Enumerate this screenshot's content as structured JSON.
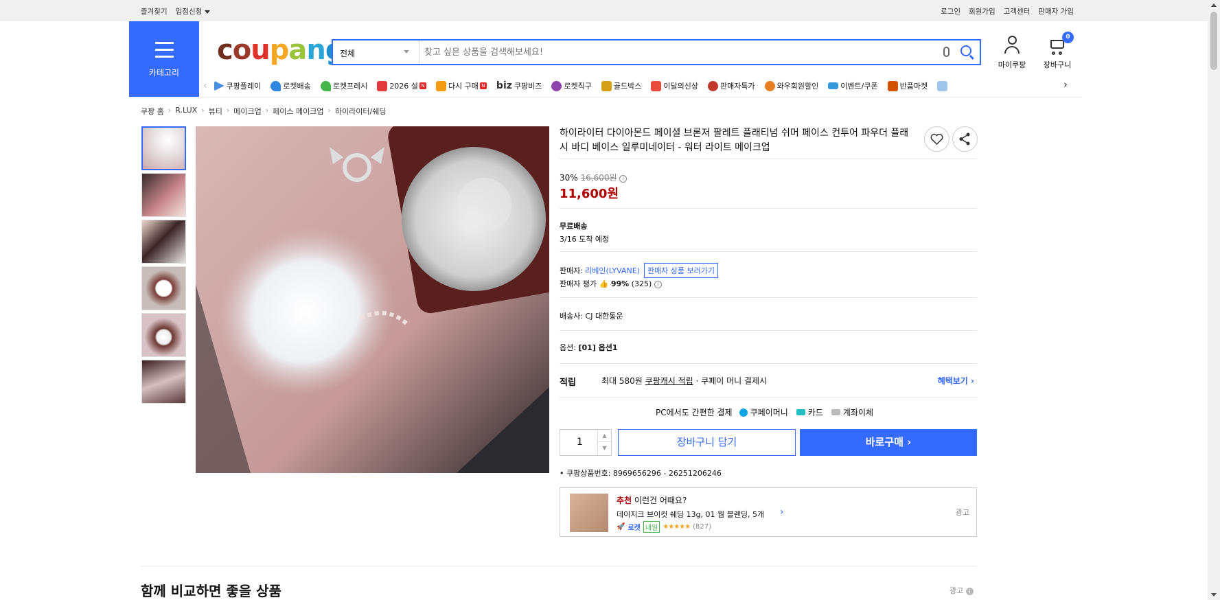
{
  "topbar": {
    "left": [
      "즐겨찾기",
      "입점신청"
    ],
    "right": [
      "로그인",
      "회원가입",
      "고객센터",
      "판매자 가입"
    ]
  },
  "header": {
    "category_label": "카테고리",
    "logo": [
      "c",
      "o",
      "u",
      "p",
      "a",
      "n",
      "g"
    ],
    "search_select": "전체",
    "search_placeholder": "찾고 싶은 상품을 검색해보세요!",
    "mycoupang": "마이쿠팡",
    "cart": "장바구니",
    "cart_count": "0"
  },
  "nav": {
    "items": [
      {
        "label": "쿠팡플레이",
        "icon": "play-icon",
        "color": "#4a90e2"
      },
      {
        "label": "로켓배송",
        "icon": "rocket-icon",
        "color": "#2e86de"
      },
      {
        "label": "로켓프레시",
        "icon": "rocket-fresh-icon",
        "color": "#44b549"
      },
      {
        "label": "2026 설",
        "icon": "gift-icon",
        "color": "#e23b3b",
        "badge": "N"
      },
      {
        "label": "다시 구매",
        "icon": "bag-icon",
        "color": "#f39c12",
        "badge": "N"
      },
      {
        "label": "쿠팡비즈",
        "icon": "biz-icon",
        "color": "#333333",
        "prefix": "biz"
      },
      {
        "label": "로켓직구",
        "icon": "globe-icon",
        "color": "#8e44ad"
      },
      {
        "label": "골드박스",
        "icon": "goldbox-icon",
        "color": "#d4a017"
      },
      {
        "label": "이달의신상",
        "icon": "new-icon",
        "color": "#e74c3c"
      },
      {
        "label": "판매자특가",
        "icon": "percent-icon",
        "color": "#c0392b"
      },
      {
        "label": "와우회원할인",
        "icon": "wow-icon",
        "color": "#e67e22"
      },
      {
        "label": "이벤트/쿠폰",
        "icon": "coupon-icon",
        "color": "#3498db"
      },
      {
        "label": "반품마켓",
        "icon": "market-icon",
        "color": "#d35400"
      }
    ]
  },
  "breadcrumb": [
    "쿠팡 홈",
    "R.LUX",
    "뷰티",
    "메이크업",
    "페이스 메이크업",
    "하이라이터/쉐딩"
  ],
  "product": {
    "title": "하이라이터 다이아몬드 페이셜 브론저 팔레트 플래티넘 쉬머 페이스 컨투어 파우더 플래시 바디 베이스 일루미네이터 - 워터 라이트 메이크업",
    "discount": "30%",
    "original_price": "16,600원",
    "price": "11,600원",
    "shipping": "무료배송",
    "arrival": "3/16 도착 예정",
    "seller_label": "판매자:",
    "seller_name": "리베인(LYVANE)",
    "seller_link": "판매자 상품 보러가기",
    "seller_rating_label": "판매자 평가",
    "seller_rating": "99%",
    "seller_rating_count": "(325)",
    "courier": "배송사:  CJ 대한통운",
    "option_label": "옵션:",
    "option_value": "[01] 옵션1",
    "reward_label": "적립",
    "reward_text_1": "최대 580원",
    "reward_link": "쿠팡캐시 적립",
    "reward_text_2": "· 쿠페이 머니 결제시",
    "reward_more": "혜택보기",
    "pay_label": "PC에서도 간편한 결제",
    "pay_coupay": "쿠페이머니",
    "pay_card": "카드",
    "pay_bank": "계좌이체",
    "quantity": "1",
    "add_cart": "장바구니 담기",
    "buy_now": "바로구매",
    "product_id": "쿠팡상품번호: 8969656296 - 26251206246"
  },
  "recommend": {
    "head_em": "추천",
    "head": "이런건 어때요?",
    "name": "데이지크 브이컷 쉐딩 13g, 01 웜 블렌딩, 5개",
    "rocket": "로켓",
    "rocket_tag": "내일",
    "rating": 4.5,
    "count": "(827)",
    "ad": "광고"
  },
  "section": {
    "compare_title": "함께 비교하면 좋을 상품",
    "ad": "광고"
  }
}
